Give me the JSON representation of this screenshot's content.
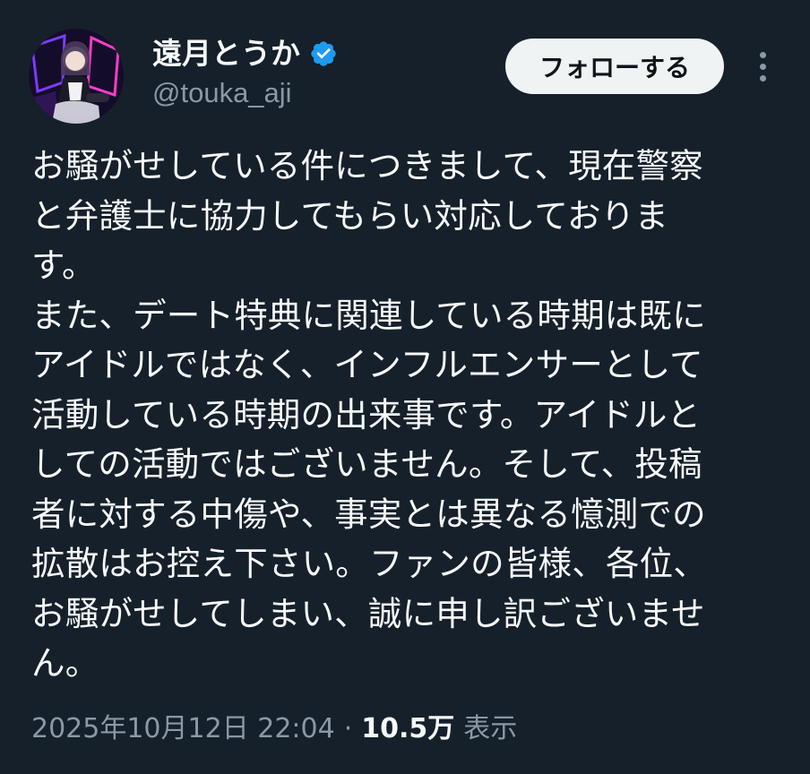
{
  "author": {
    "display_name": "遠月とうか",
    "handle": "@touka_aji",
    "verified": true,
    "verified_icon": "verified-badge-icon",
    "avatar_icon": "avatar-photo"
  },
  "actions": {
    "follow_label": "フォローする",
    "more_icon": "more-vertical-icon"
  },
  "tweet": {
    "text": "お騒がせしている件につきまして、現在警察\nと弁護士に協力してもらい対応しておりま\nす。\nまた、デート特典に関連している時期は既に\nアイドルではなく、インフルエンサーとして\n活動している時期の出来事です。アイドルと\nしての活動ではございません。そして、投稿\n者に対する中傷や、事実とは異なる憶測での\n拡散はお控え下さい。ファンの皆様、各位、\nお騒がせしてしまい、誠に申し訳ございませ\nん。"
  },
  "meta": {
    "timestamp": "2025年10月12日 22:04",
    "separator": "·",
    "views_count": "10.5万",
    "views_label": "表示"
  },
  "colors": {
    "background": "#15202b",
    "text": "#f7f9f9",
    "secondary": "#8b98a5",
    "verified": "#1d9bf0",
    "button_bg": "#eff3f4"
  }
}
